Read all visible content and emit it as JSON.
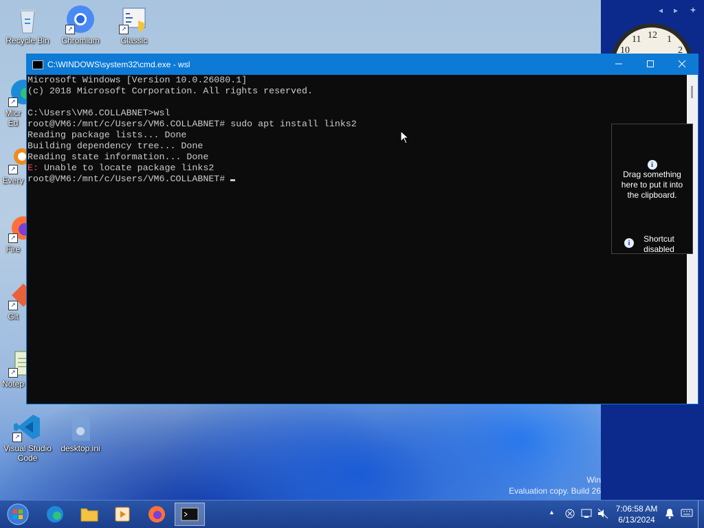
{
  "desktop": {
    "icons": [
      {
        "label": "Recycle Bin"
      },
      {
        "label": "Chromium"
      },
      {
        "label": "Classic"
      },
      {
        "label": "Micr Ed"
      },
      {
        "label": "Every"
      },
      {
        "label": "Fire"
      },
      {
        "label": "Git"
      },
      {
        "label": "Notep"
      },
      {
        "label": "Visual Studio Code"
      },
      {
        "label": "desktop.ini"
      }
    ],
    "watermark": {
      "line1": "Win",
      "line2": "Evaluation copy. Build 26"
    }
  },
  "gadget": {
    "prev": "◂",
    "next": "▸",
    "add": "+"
  },
  "clock_face": {
    "n11": "11",
    "n12": "12",
    "n1": "1",
    "n10": "10",
    "n2": "2"
  },
  "console": {
    "title": "C:\\WINDOWS\\system32\\cmd.exe - wsl",
    "lines": [
      {
        "text": "Microsoft Windows [Version 10.0.26080.1]"
      },
      {
        "text": "(c) 2018 Microsoft Corporation. All rights reserved."
      },
      {
        "text": ""
      },
      {
        "text": "C:\\Users\\VM6.COLLABNET>wsl"
      },
      {
        "text": "root@VM6:/mnt/c/Users/VM6.COLLABNET# sudo apt install links2"
      },
      {
        "text": "Reading package lists... Done"
      },
      {
        "text": "Building dependency tree... Done"
      },
      {
        "text": "Reading state information... Done"
      },
      {
        "err_prefix": "E:",
        "text": " Unable to locate package links2"
      },
      {
        "text": "root@VM6:/mnt/c/Users/VM6.COLLABNET# "
      }
    ]
  },
  "clipboard": {
    "drag_text": "Drag something here to put it into the clipboard.",
    "shortcut_text": "Shortcut disabled",
    "info_glyph": "i"
  },
  "taskbar": {
    "time": "7:06:58 AM",
    "date": "6/13/2024",
    "tray_up": "▲"
  }
}
